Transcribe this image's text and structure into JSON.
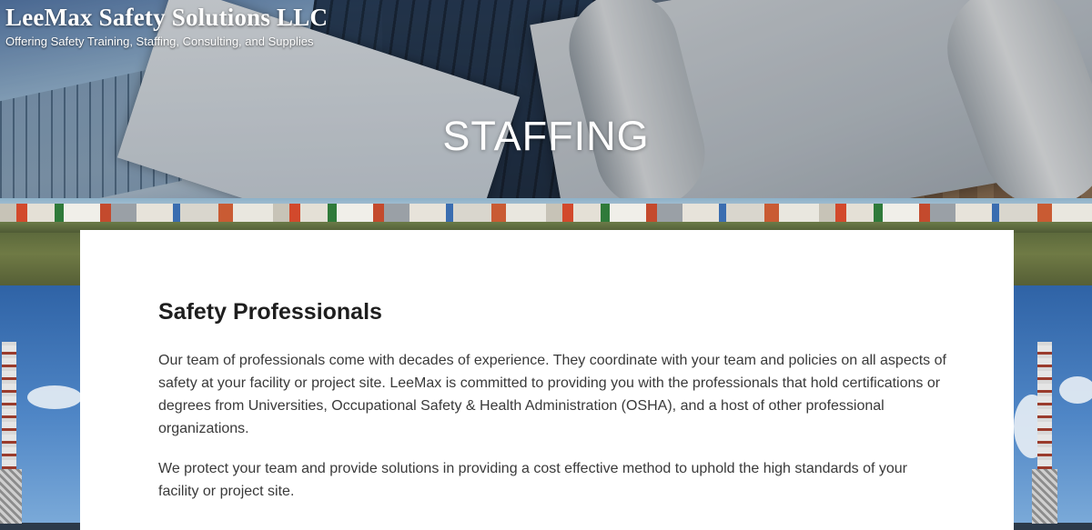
{
  "site": {
    "title": "LeeMax Safety Solutions LLC",
    "tagline": "Offering Safety Training, Staffing, Consulting, and Supplies"
  },
  "page": {
    "title": "STAFFING"
  },
  "content": {
    "heading": "Safety Professionals",
    "paragraphs": [
      "Our team of professionals come with decades of experience. They coordinate with your team and policies on all aspects of safety at your facility or project site. LeeMax is committed to providing you with the professionals that hold certifications or degrees from Universities, Occupational Safety & Health Administration (OSHA), and a host of other professional organizations.",
      "We protect your team and provide solutions in providing a cost effective method to uphold the high standards of your facility or project site."
    ]
  },
  "colors": {
    "text_dark": "#1e1e1e",
    "text_body": "#3a3a3a",
    "card_bg": "#ffffff",
    "header_text": "#ffffff"
  }
}
